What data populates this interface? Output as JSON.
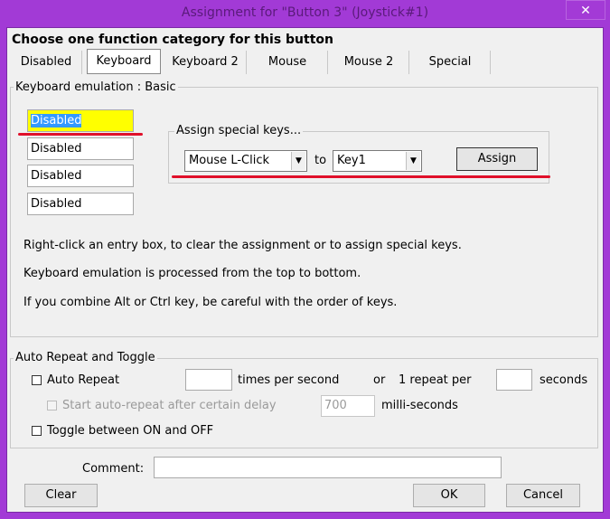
{
  "window": {
    "title": "Assignment for \"Button 3\" (Joystick#1)",
    "close_glyph": "✕"
  },
  "heading": "Choose one function category for this button",
  "tabs": [
    {
      "label": "Disabled",
      "active": false
    },
    {
      "label": "Keyboard",
      "active": true
    },
    {
      "label": "Keyboard 2",
      "active": false
    },
    {
      "label": "Mouse",
      "active": false
    },
    {
      "label": "Mouse 2",
      "active": false
    },
    {
      "label": "Special",
      "active": false
    }
  ],
  "keyboard_group": {
    "label": "Keyboard emulation : Basic",
    "entries": [
      "Disabled",
      "Disabled",
      "Disabled",
      "Disabled"
    ],
    "special": {
      "label": "Assign special keys...",
      "key_select": "Mouse L-Click",
      "to_label": "to",
      "target_select": "Key1",
      "assign_button": "Assign"
    },
    "help": [
      "Right-click an entry box, to clear the assignment or to assign special keys.",
      "Keyboard emulation is processed from the top to bottom.",
      "If you combine Alt or Ctrl key, be careful with the order of keys."
    ]
  },
  "repeat_group": {
    "label": "Auto Repeat and Toggle",
    "auto_repeat": {
      "label": "Auto Repeat",
      "checked": false
    },
    "times_value": "",
    "times_label": "times per second",
    "or_label": "or",
    "one_repeat_label": "1 repeat per",
    "seconds_value": "",
    "seconds_label": "seconds",
    "delay": {
      "label": "Start auto-repeat after certain delay",
      "checked": false,
      "enabled": false
    },
    "delay_value": "700",
    "delay_unit": "milli-seconds",
    "toggle": {
      "label": "Toggle between ON and OFF",
      "checked": false
    }
  },
  "comment": {
    "label": "Comment:",
    "value": ""
  },
  "buttons": {
    "clear": "Clear",
    "ok": "OK",
    "cancel": "Cancel"
  },
  "colors": {
    "annotation": "#e0102a",
    "highlight": "#ffff00",
    "selection": "#3399ff",
    "title_bar": "#a23ad6"
  }
}
